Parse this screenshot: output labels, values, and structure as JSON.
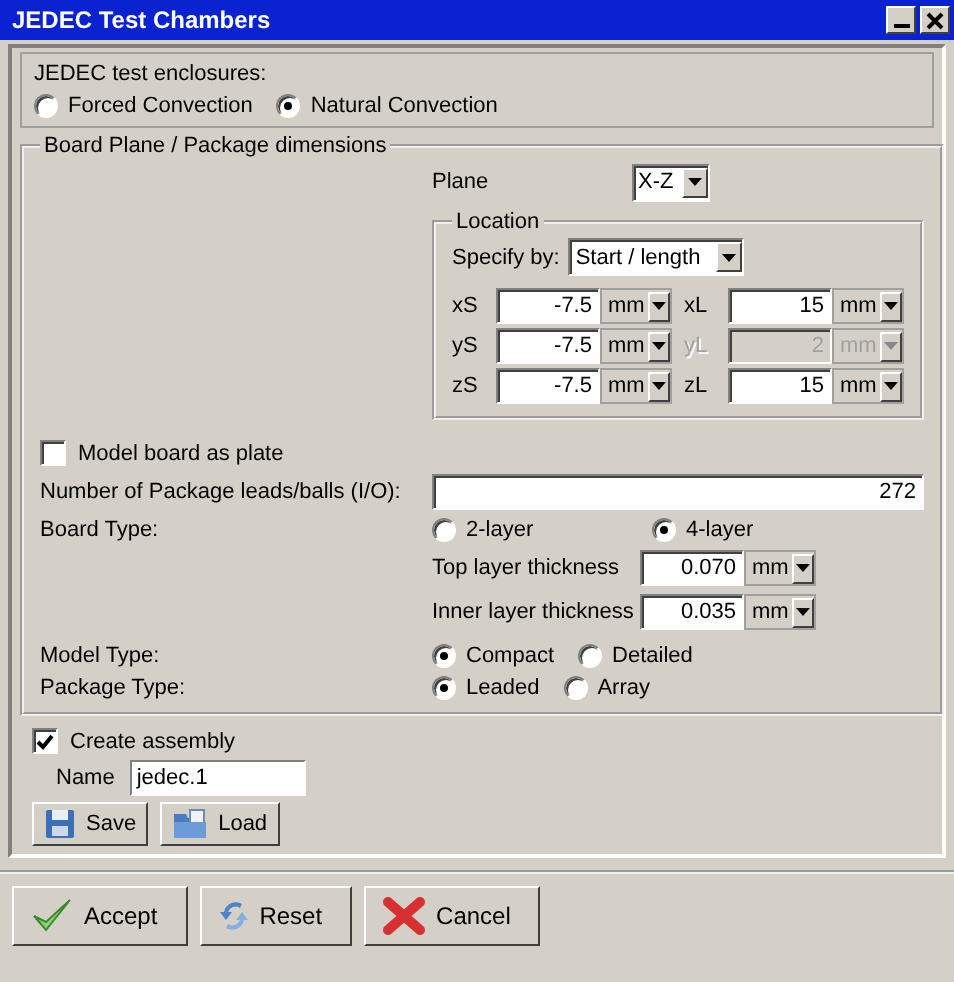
{
  "window": {
    "title": "JEDEC Test Chambers"
  },
  "enclosures": {
    "label": "JEDEC test enclosures:",
    "options": [
      {
        "label": "Forced Convection",
        "selected": false
      },
      {
        "label": "Natural Convection",
        "selected": true
      }
    ]
  },
  "board": {
    "title": "Board Plane / Package dimensions",
    "plane": {
      "label": "Plane",
      "value": "X-Z"
    },
    "location": {
      "title": "Location",
      "specify_by": {
        "label": "Specify by:",
        "value": "Start / length"
      },
      "fields": [
        {
          "label": "xS",
          "value": "-7.5",
          "unit": "mm",
          "disabled": false
        },
        {
          "label": "xL",
          "value": "15",
          "unit": "mm",
          "disabled": false
        },
        {
          "label": "yS",
          "value": "-7.5",
          "unit": "mm",
          "disabled": false
        },
        {
          "label": "yL",
          "value": "2",
          "unit": "mm",
          "disabled": true
        },
        {
          "label": "zS",
          "value": "-7.5",
          "unit": "mm",
          "disabled": false
        },
        {
          "label": "zL",
          "value": "15",
          "unit": "mm",
          "disabled": false
        }
      ]
    },
    "model_board_as_plate": {
      "label": "Model board as plate",
      "checked": false
    },
    "leads": {
      "label": "Number of Package leads/balls (I/O):",
      "value": "272"
    },
    "board_type": {
      "label": "Board Type:",
      "options": [
        {
          "label": "2-layer",
          "selected": false
        },
        {
          "label": "4-layer",
          "selected": true
        }
      ]
    },
    "thickness": [
      {
        "label": "Top layer thickness",
        "value": "0.070",
        "unit": "mm"
      },
      {
        "label": "Inner layer thickness",
        "value": "0.035",
        "unit": "mm"
      }
    ],
    "model_type": {
      "label": "Model Type:",
      "options": [
        {
          "label": "Compact",
          "selected": true
        },
        {
          "label": "Detailed",
          "selected": false
        }
      ]
    },
    "package_type": {
      "label": "Package Type:",
      "options": [
        {
          "label": "Leaded",
          "selected": true
        },
        {
          "label": "Array",
          "selected": false
        }
      ]
    }
  },
  "create_assembly": {
    "label": "Create assembly",
    "checked": true
  },
  "name": {
    "label": "Name",
    "value": "jedec.1"
  },
  "file_buttons": [
    {
      "label": "Save",
      "kind": "save"
    },
    {
      "label": "Load",
      "kind": "load"
    }
  ],
  "buttons": [
    {
      "label": "Accept",
      "kind": "accept"
    },
    {
      "label": "Reset",
      "kind": "reset"
    },
    {
      "label": "Cancel",
      "kind": "cancel"
    }
  ]
}
